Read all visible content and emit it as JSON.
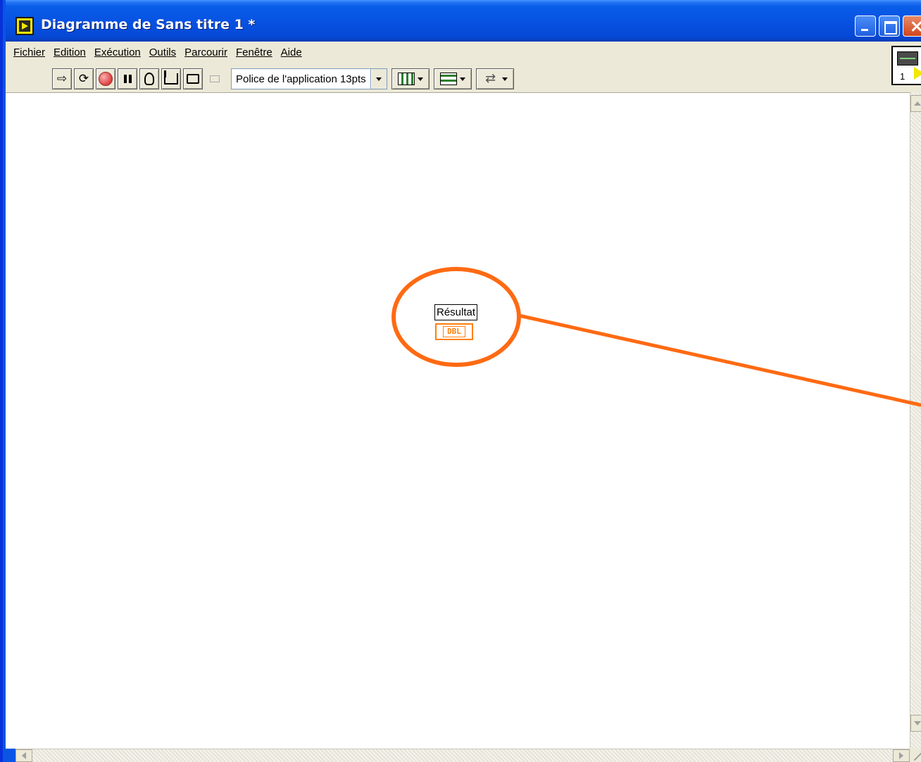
{
  "window": {
    "title": "Diagramme de Sans titre 1 *",
    "title_icon": "labview-diagram-icon"
  },
  "menubar": {
    "items": [
      {
        "label": "Fichier"
      },
      {
        "label": "Edition"
      },
      {
        "label": "Exécution"
      },
      {
        "label": "Outils"
      },
      {
        "label": "Parcourir"
      },
      {
        "label": "Fenêtre"
      },
      {
        "label": "Aide"
      }
    ]
  },
  "toolbar": {
    "buttons": [
      "run-arrow-icon",
      "run-continuously-icon",
      "abort-icon",
      "pause-icon",
      "highlight-execution-icon",
      "step-into-icon",
      "step-over-icon",
      "step-out-icon"
    ],
    "font_select": "Police de l'application 13pts",
    "dropdowns": [
      "align-objects-icon",
      "distribute-objects-icon",
      "reorder-objects-icon"
    ]
  },
  "vi_icon": {
    "label": "1"
  },
  "diagram": {
    "terminal_label": "Résultat",
    "terminal_type": "DBL"
  },
  "colors": {
    "accent": "#ff6a13",
    "terminal": "#ff7f0e",
    "titlebar": "#0752e2"
  }
}
